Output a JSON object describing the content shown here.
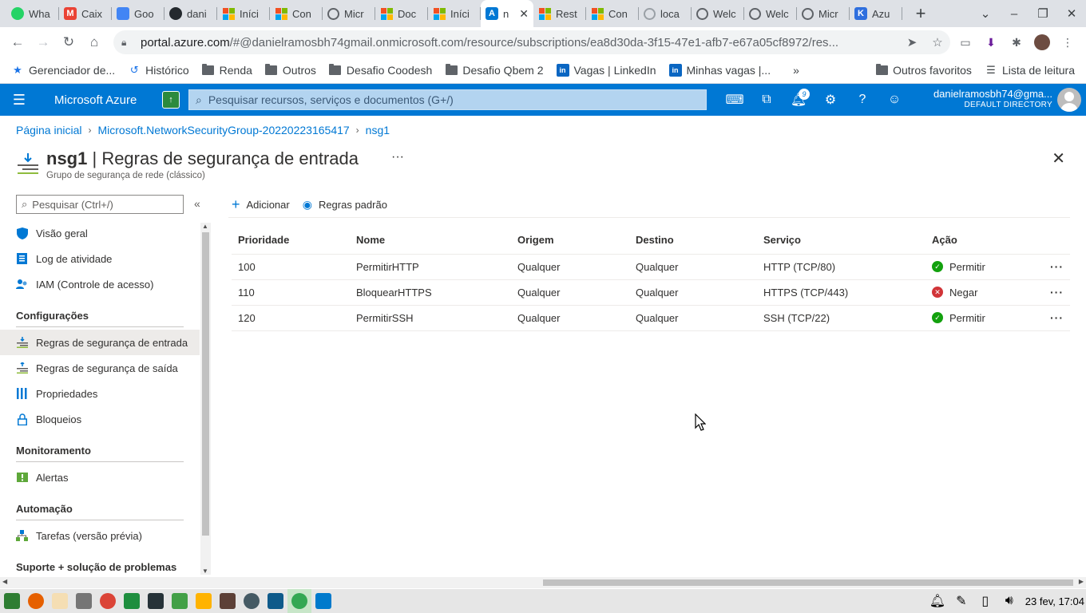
{
  "browser": {
    "tabs": [
      {
        "label": "Wha",
        "icon": "whatsapp-icon",
        "color": "#25d366"
      },
      {
        "label": "Caix",
        "icon": "gmail-icon",
        "color": "#ea4335"
      },
      {
        "label": "Goo",
        "icon": "google-calendar-icon",
        "color": "#4285f4"
      },
      {
        "label": "dani",
        "icon": "github-icon",
        "color": "#24292e"
      },
      {
        "label": "Iníci",
        "icon": "microsoft-icon",
        "color": "#f25022"
      },
      {
        "label": "Con",
        "icon": "microsoft-icon",
        "color": "#f25022"
      },
      {
        "label": "Micr",
        "icon": "globe-icon",
        "color": "#5f6368"
      },
      {
        "label": "Doc",
        "icon": "microsoft-icon",
        "color": "#f25022"
      },
      {
        "label": "Iníci",
        "icon": "microsoft-icon",
        "color": "#f25022"
      },
      {
        "label": "n",
        "icon": "azure-icon",
        "color": "#0078d4",
        "active": true
      },
      {
        "label": "Rest",
        "icon": "microsoft-icon",
        "color": "#f25022"
      },
      {
        "label": "Con",
        "icon": "microsoft-icon",
        "color": "#f25022"
      },
      {
        "label": "loca",
        "icon": "globe-icon",
        "color": "#9aa0a6"
      },
      {
        "label": "Welc",
        "icon": "globe-icon",
        "color": "#5f6368"
      },
      {
        "label": "Welc",
        "icon": "globe-icon",
        "color": "#5f6368"
      },
      {
        "label": "Micr",
        "icon": "globe-icon",
        "color": "#5f6368"
      },
      {
        "label": "Azu",
        "icon": "kubernetes-icon",
        "color": "#2f6fde"
      }
    ],
    "url_host": "portal.azure.com",
    "url_rest": "/#@danielramosbh74gmail.onmicrosoft.com/resource/subscriptions/ea8d30da-3f15-47e1-afb7-e67a05cf8972/res...",
    "bookmarks": [
      {
        "label": "Gerenciador de...",
        "icon": "star-icon"
      },
      {
        "label": "Histórico",
        "icon": "history-icon"
      },
      {
        "label": "Renda",
        "icon": "folder-icon"
      },
      {
        "label": "Outros",
        "icon": "folder-icon"
      },
      {
        "label": "Desafio Coodesh",
        "icon": "folder-icon"
      },
      {
        "label": "Desafio Qbem 2",
        "icon": "folder-icon"
      },
      {
        "label": "Vagas | LinkedIn",
        "icon": "linkedin-icon"
      },
      {
        "label": "Minhas vagas |...",
        "icon": "linkedin-icon"
      }
    ],
    "bookmarks_more": "»",
    "other_favorites": "Outros favoritos",
    "reading_list": "Lista de leitura"
  },
  "azure": {
    "brand": "Microsoft Azure",
    "search_placeholder": "Pesquisar recursos, serviços e documentos (G+/)",
    "notification_count": "9",
    "account_email": "danielramosbh74@gma...",
    "account_directory": "DEFAULT DIRECTORY",
    "accent": "#0078d4"
  },
  "breadcrumb": {
    "home": "Página inicial",
    "group": "Microsoft.NetworkSecurityGroup-20220223165417",
    "current": "nsg1"
  },
  "page": {
    "resource": "nsg1",
    "title_sep": " | ",
    "title": "Regras de segurança de entrada",
    "subtitle": "Grupo de segurança de rede (clássico)",
    "more": "···"
  },
  "sidebar": {
    "search_placeholder": "Pesquisar (Ctrl+/)",
    "collapse": "«",
    "items": [
      {
        "label": "Visão geral"
      },
      {
        "label": "Log de atividade"
      },
      {
        "label": "IAM (Controle de acesso)"
      },
      {
        "label": "Regras de segurança de entrada"
      },
      {
        "label": "Regras de segurança de saída"
      },
      {
        "label": "Propriedades"
      },
      {
        "label": "Bloqueios"
      },
      {
        "label": "Alertas"
      },
      {
        "label": "Tarefas (versão prévia)"
      }
    ],
    "sections": {
      "config": "Configurações",
      "monitor": "Monitoramento",
      "automation": "Automação",
      "support": "Suporte + solução de problemas"
    }
  },
  "toolbar": {
    "add": "Adicionar",
    "default_rules": "Regras padrão"
  },
  "table": {
    "headers": [
      "Prioridade",
      "Nome",
      "Origem",
      "Destino",
      "Serviço",
      "Ação"
    ],
    "rows": [
      {
        "priority": "100",
        "name": "PermitirHTTP",
        "source": "Qualquer",
        "dest": "Qualquer",
        "service": "HTTP (TCP/80)",
        "action": "Permitir",
        "action_type": "allow"
      },
      {
        "priority": "110",
        "name": "BloquearHTTPS",
        "source": "Qualquer",
        "dest": "Qualquer",
        "service": "HTTPS (TCP/443)",
        "action": "Negar",
        "action_type": "deny"
      },
      {
        "priority": "120",
        "name": "PermitirSSH",
        "source": "Qualquer",
        "dest": "Qualquer",
        "service": "SSH (TCP/22)",
        "action": "Permitir",
        "action_type": "allow"
      }
    ],
    "row_menu": "···"
  },
  "taskbar": {
    "datetime": "23 fev, 17:04"
  }
}
